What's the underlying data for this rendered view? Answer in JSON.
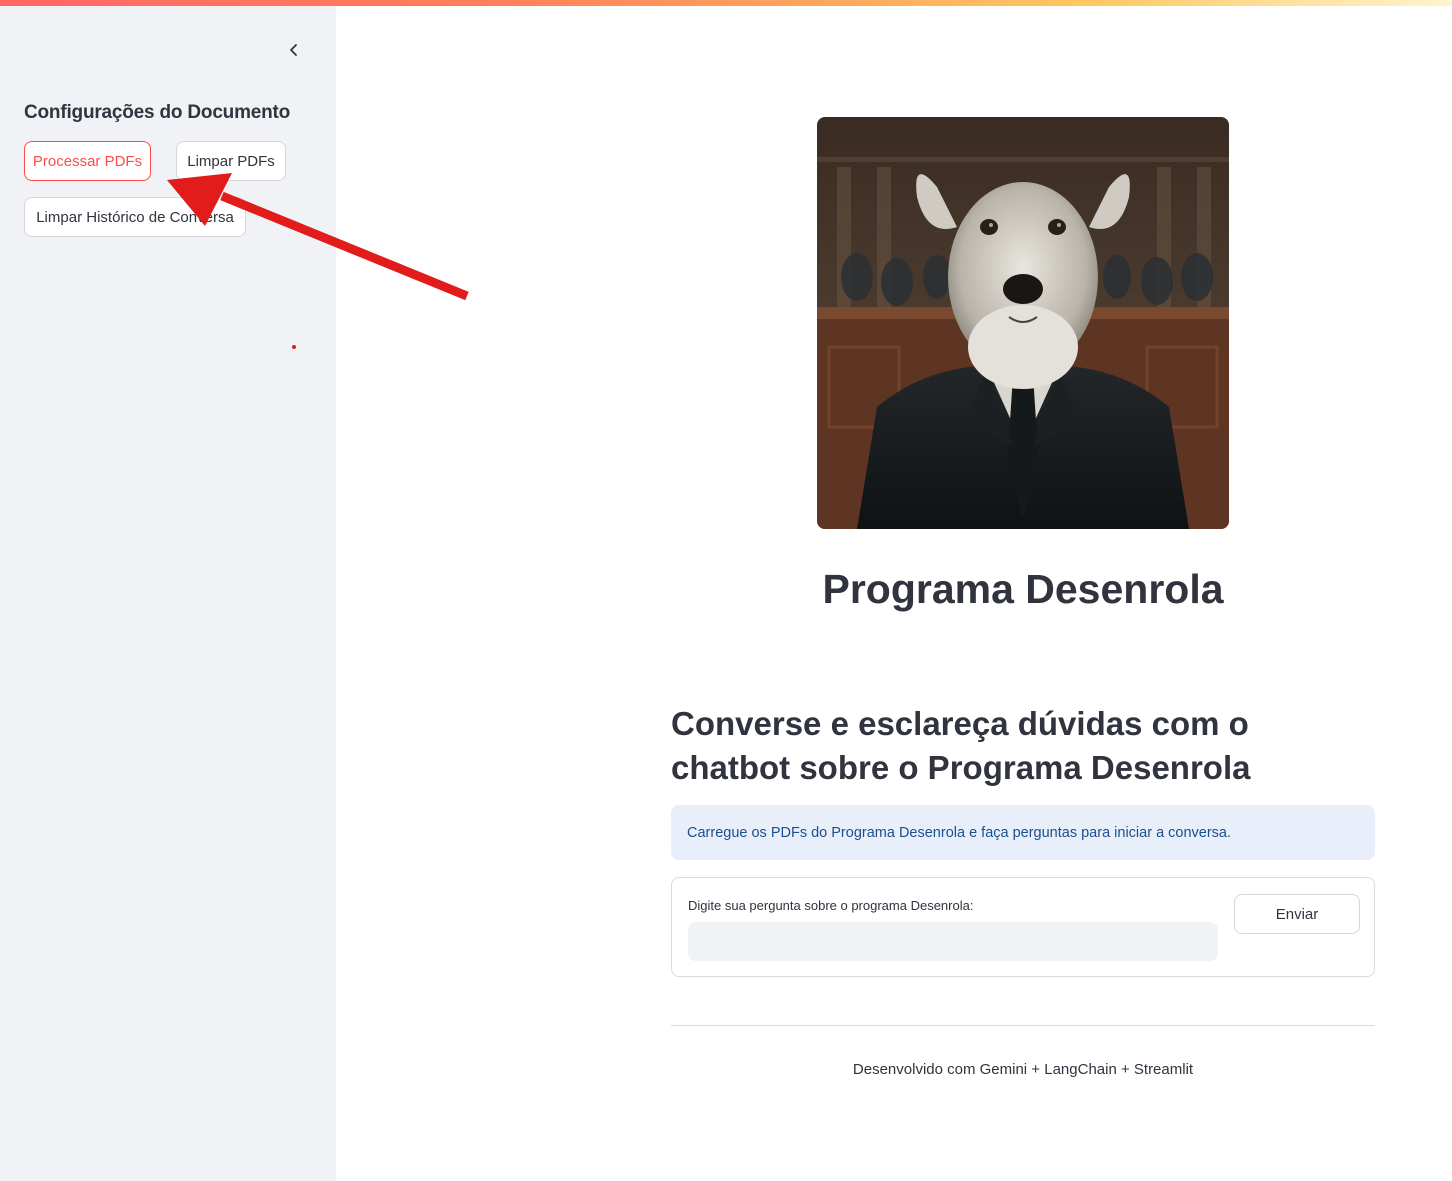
{
  "sidebar": {
    "collapse_icon": "chevron-left-icon",
    "title": "Configurações do Documento",
    "buttons": {
      "process": "Processar PDFs",
      "clear_pdfs": "Limpar PDFs",
      "clear_history": "Limpar Histórico de Conversa"
    }
  },
  "main": {
    "hero_image_icon": "dog-in-suit-portrait",
    "title": "Programa Desenrola",
    "subheading": "Converse e esclareça dúvidas com o chatbot sobre o Programa Desenrola",
    "info": "Carregue os PDFs do Programa Desenrola e faça perguntas para iniciar a conversa.",
    "form": {
      "label": "Digite sua pergunta sobre o programa Desenrola:",
      "value": "",
      "submit": "Enviar"
    },
    "footer": "Desenvolvido com Gemini + LangChain + Streamlit"
  },
  "colors": {
    "accent": "#ff4b4b",
    "sidebar_bg": "#f0f2f6",
    "info_bg": "#e8effa",
    "info_text": "#1c4f8c",
    "annotation_arrow": "#e21b1b"
  }
}
